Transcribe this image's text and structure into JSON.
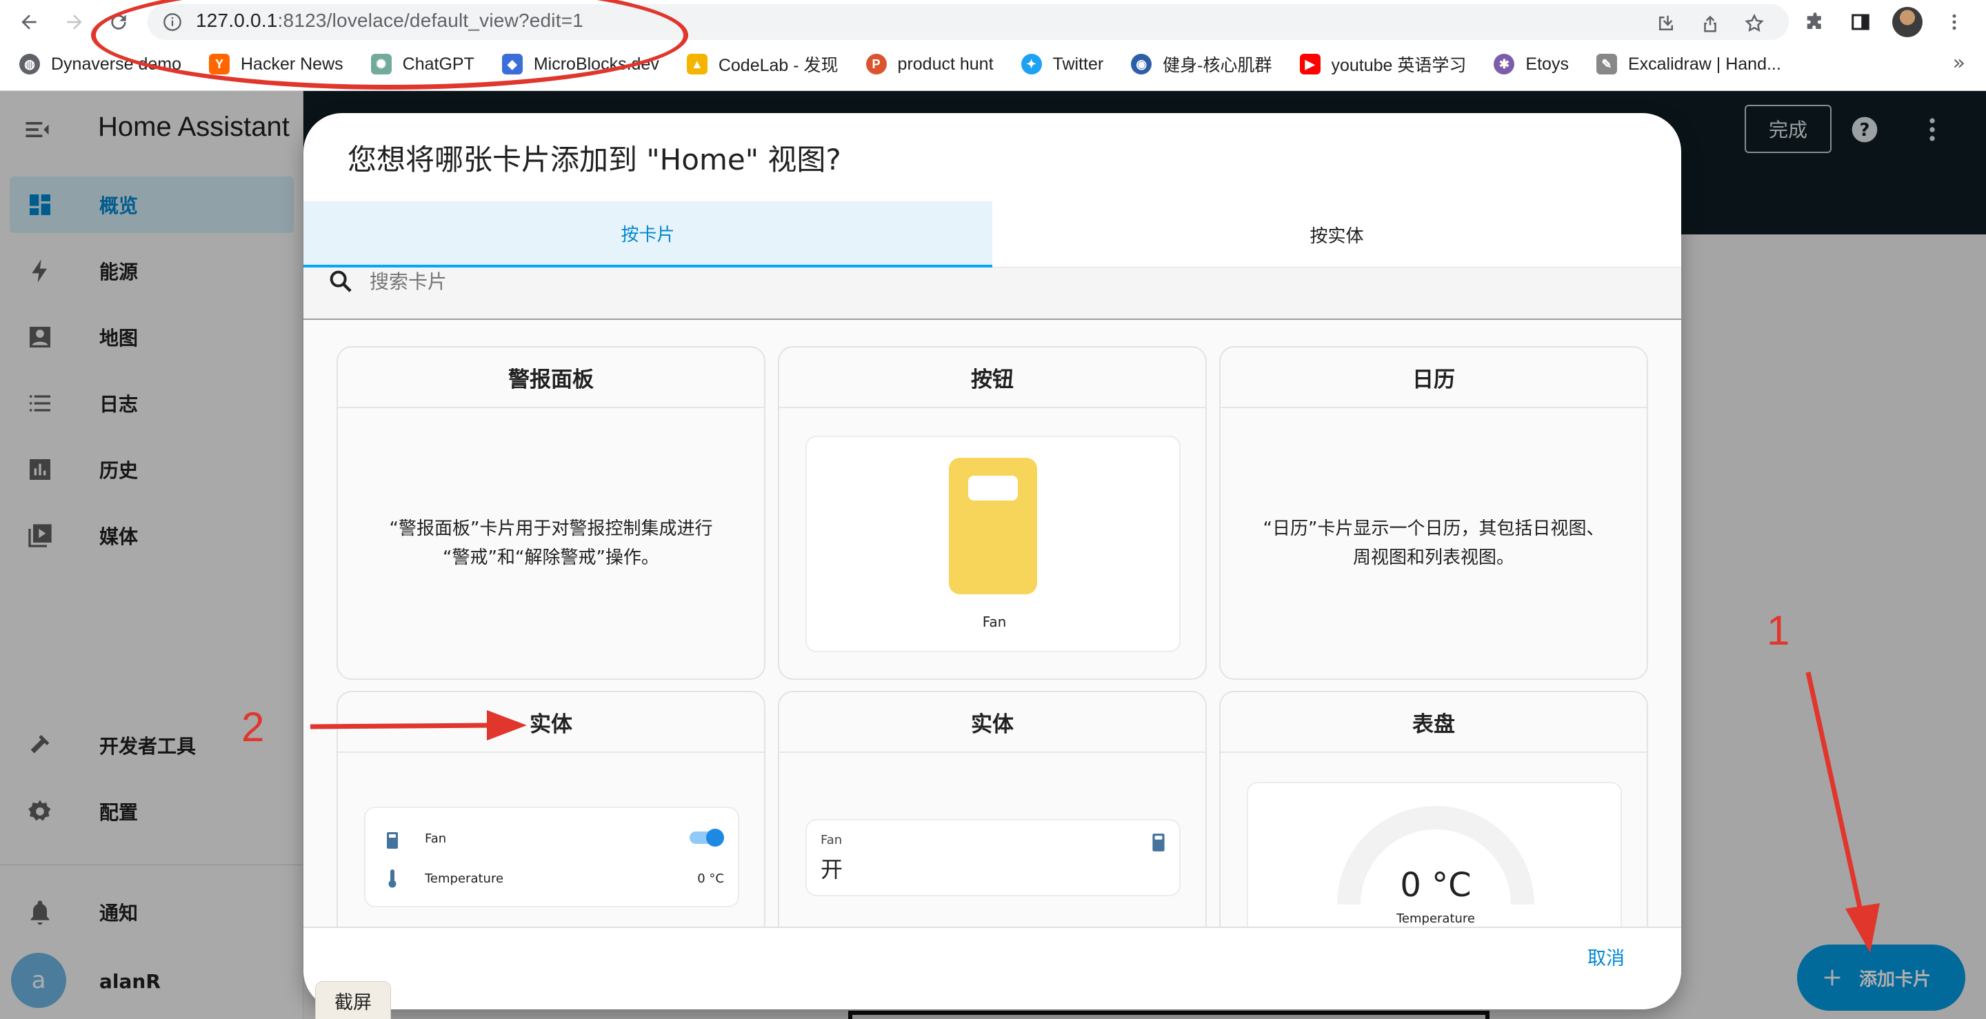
{
  "browser": {
    "url_host": "127.0.0.1",
    "url_rest": ":8123/lovelace/default_view?edit=1",
    "bookmarks": [
      {
        "label": "Dynaverse demo",
        "icon": "globe-icon",
        "color": "#5f6368"
      },
      {
        "label": "Hacker News",
        "icon": "Y",
        "color": "#ff6600"
      },
      {
        "label": "ChatGPT",
        "icon": "openai-icon",
        "color": "#74aa9c"
      },
      {
        "label": "MicroBlocks.dev",
        "icon": "shield-icon",
        "color": "#3b6ed8"
      },
      {
        "label": "CodeLab - 发现",
        "icon": "codelab-icon",
        "color": "#f4b400"
      },
      {
        "label": "product hunt",
        "icon": "P",
        "color": "#da552f"
      },
      {
        "label": "Twitter",
        "icon": "twitter-bird-icon",
        "color": "#1da1f2"
      },
      {
        "label": "健身-核心肌群",
        "icon": "circle-logo-icon",
        "color": "#2d5fa8"
      },
      {
        "label": "youtube 英语学习",
        "icon": "youtube-play-icon",
        "color": "#ff0000"
      },
      {
        "label": "Etoys",
        "icon": "etoys-icon",
        "color": "#7b5ea7"
      },
      {
        "label": "Excalidraw | Hand...",
        "icon": "excalidraw-icon",
        "color": "#888888"
      }
    ],
    "more_label": "»"
  },
  "app": {
    "title": "Home Assistant",
    "sidebar": {
      "items": [
        {
          "label": "概览",
          "icon": "dashboard-icon"
        },
        {
          "label": "能源",
          "icon": "lightning-icon"
        },
        {
          "label": "地图",
          "icon": "account-box-icon"
        },
        {
          "label": "日志",
          "icon": "list-icon"
        },
        {
          "label": "历史",
          "icon": "chart-bar-icon"
        },
        {
          "label": "媒体",
          "icon": "media-play-icon"
        }
      ],
      "dev_tools": "开发者工具",
      "settings": "配置",
      "notifications": "通知",
      "user_initial": "a",
      "user_name": "alanR"
    },
    "toolbar": {
      "done_label": "完成"
    },
    "fab_label": "添加卡片"
  },
  "dialog": {
    "title": "您想将哪张卡片添加到 \"Home\" 视图?",
    "tabs": [
      "按卡片",
      "按实体"
    ],
    "search_placeholder": "搜索卡片",
    "cards": [
      {
        "title": "警报面板",
        "desc_line1": "“警报面板”卡片用于对警报控制集成进行",
        "desc_line2": "“警戒”和“解除警戒”操作。"
      },
      {
        "title": "按钮",
        "preview_label": "Fan"
      },
      {
        "title": "日历",
        "desc_line1": "“日历”卡片显示一个日历，其包括日视图、",
        "desc_line2": "周视图和列表视图。"
      },
      {
        "title": "实体",
        "row1": "Fan",
        "row2": "Temperature",
        "row2_value": "0 °C"
      },
      {
        "title": "实体",
        "entity_name": "Fan",
        "entity_state": "开"
      },
      {
        "title": "表盘",
        "gauge_value": "0 °C",
        "gauge_label": "Temperature"
      }
    ],
    "cancel_label": "取消"
  },
  "annotations": {
    "num1": "1",
    "num2": "2",
    "capture_label": "截屏"
  }
}
